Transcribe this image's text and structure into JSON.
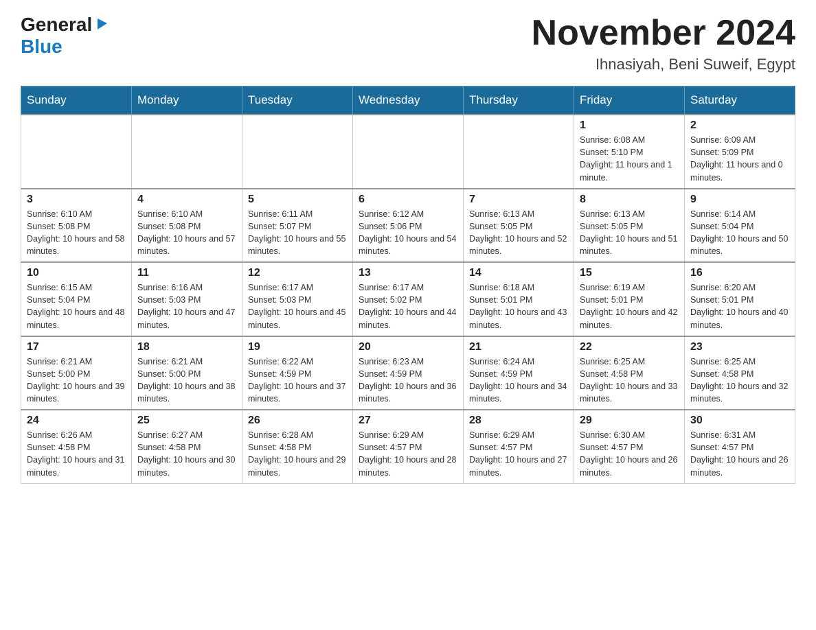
{
  "header": {
    "logo_general": "General",
    "logo_triangle": "▶",
    "logo_blue": "Blue",
    "title": "November 2024",
    "subtitle": "Ihnasiyah, Beni Suweif, Egypt"
  },
  "days_of_week": [
    "Sunday",
    "Monday",
    "Tuesday",
    "Wednesday",
    "Thursday",
    "Friday",
    "Saturday"
  ],
  "weeks": [
    {
      "days": [
        {
          "number": "",
          "info": ""
        },
        {
          "number": "",
          "info": ""
        },
        {
          "number": "",
          "info": ""
        },
        {
          "number": "",
          "info": ""
        },
        {
          "number": "",
          "info": ""
        },
        {
          "number": "1",
          "info": "Sunrise: 6:08 AM\nSunset: 5:10 PM\nDaylight: 11 hours and 1 minute."
        },
        {
          "number": "2",
          "info": "Sunrise: 6:09 AM\nSunset: 5:09 PM\nDaylight: 11 hours and 0 minutes."
        }
      ]
    },
    {
      "days": [
        {
          "number": "3",
          "info": "Sunrise: 6:10 AM\nSunset: 5:08 PM\nDaylight: 10 hours and 58 minutes."
        },
        {
          "number": "4",
          "info": "Sunrise: 6:10 AM\nSunset: 5:08 PM\nDaylight: 10 hours and 57 minutes."
        },
        {
          "number": "5",
          "info": "Sunrise: 6:11 AM\nSunset: 5:07 PM\nDaylight: 10 hours and 55 minutes."
        },
        {
          "number": "6",
          "info": "Sunrise: 6:12 AM\nSunset: 5:06 PM\nDaylight: 10 hours and 54 minutes."
        },
        {
          "number": "7",
          "info": "Sunrise: 6:13 AM\nSunset: 5:05 PM\nDaylight: 10 hours and 52 minutes."
        },
        {
          "number": "8",
          "info": "Sunrise: 6:13 AM\nSunset: 5:05 PM\nDaylight: 10 hours and 51 minutes."
        },
        {
          "number": "9",
          "info": "Sunrise: 6:14 AM\nSunset: 5:04 PM\nDaylight: 10 hours and 50 minutes."
        }
      ]
    },
    {
      "days": [
        {
          "number": "10",
          "info": "Sunrise: 6:15 AM\nSunset: 5:04 PM\nDaylight: 10 hours and 48 minutes."
        },
        {
          "number": "11",
          "info": "Sunrise: 6:16 AM\nSunset: 5:03 PM\nDaylight: 10 hours and 47 minutes."
        },
        {
          "number": "12",
          "info": "Sunrise: 6:17 AM\nSunset: 5:03 PM\nDaylight: 10 hours and 45 minutes."
        },
        {
          "number": "13",
          "info": "Sunrise: 6:17 AM\nSunset: 5:02 PM\nDaylight: 10 hours and 44 minutes."
        },
        {
          "number": "14",
          "info": "Sunrise: 6:18 AM\nSunset: 5:01 PM\nDaylight: 10 hours and 43 minutes."
        },
        {
          "number": "15",
          "info": "Sunrise: 6:19 AM\nSunset: 5:01 PM\nDaylight: 10 hours and 42 minutes."
        },
        {
          "number": "16",
          "info": "Sunrise: 6:20 AM\nSunset: 5:01 PM\nDaylight: 10 hours and 40 minutes."
        }
      ]
    },
    {
      "days": [
        {
          "number": "17",
          "info": "Sunrise: 6:21 AM\nSunset: 5:00 PM\nDaylight: 10 hours and 39 minutes."
        },
        {
          "number": "18",
          "info": "Sunrise: 6:21 AM\nSunset: 5:00 PM\nDaylight: 10 hours and 38 minutes."
        },
        {
          "number": "19",
          "info": "Sunrise: 6:22 AM\nSunset: 4:59 PM\nDaylight: 10 hours and 37 minutes."
        },
        {
          "number": "20",
          "info": "Sunrise: 6:23 AM\nSunset: 4:59 PM\nDaylight: 10 hours and 36 minutes."
        },
        {
          "number": "21",
          "info": "Sunrise: 6:24 AM\nSunset: 4:59 PM\nDaylight: 10 hours and 34 minutes."
        },
        {
          "number": "22",
          "info": "Sunrise: 6:25 AM\nSunset: 4:58 PM\nDaylight: 10 hours and 33 minutes."
        },
        {
          "number": "23",
          "info": "Sunrise: 6:25 AM\nSunset: 4:58 PM\nDaylight: 10 hours and 32 minutes."
        }
      ]
    },
    {
      "days": [
        {
          "number": "24",
          "info": "Sunrise: 6:26 AM\nSunset: 4:58 PM\nDaylight: 10 hours and 31 minutes."
        },
        {
          "number": "25",
          "info": "Sunrise: 6:27 AM\nSunset: 4:58 PM\nDaylight: 10 hours and 30 minutes."
        },
        {
          "number": "26",
          "info": "Sunrise: 6:28 AM\nSunset: 4:58 PM\nDaylight: 10 hours and 29 minutes."
        },
        {
          "number": "27",
          "info": "Sunrise: 6:29 AM\nSunset: 4:57 PM\nDaylight: 10 hours and 28 minutes."
        },
        {
          "number": "28",
          "info": "Sunrise: 6:29 AM\nSunset: 4:57 PM\nDaylight: 10 hours and 27 minutes."
        },
        {
          "number": "29",
          "info": "Sunrise: 6:30 AM\nSunset: 4:57 PM\nDaylight: 10 hours and 26 minutes."
        },
        {
          "number": "30",
          "info": "Sunrise: 6:31 AM\nSunset: 4:57 PM\nDaylight: 10 hours and 26 minutes."
        }
      ]
    }
  ]
}
